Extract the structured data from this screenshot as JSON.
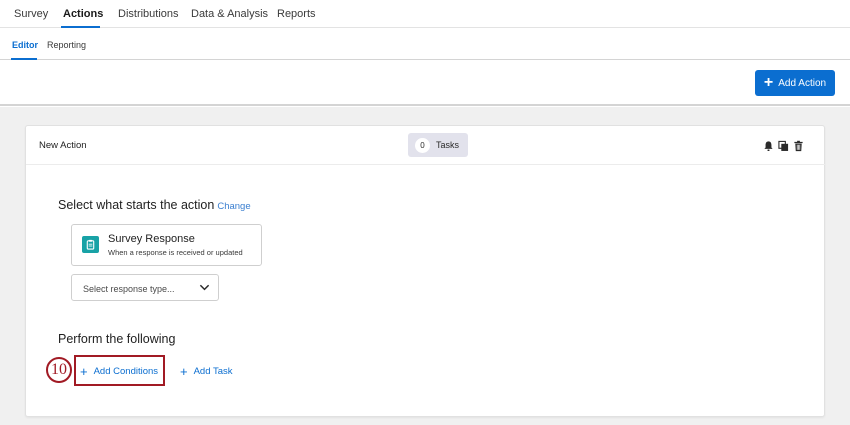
{
  "top_nav": {
    "tabs": [
      "Survey",
      "Actions",
      "Distributions",
      "Data & Analysis",
      "Reports"
    ],
    "active": "Actions"
  },
  "sub_nav": {
    "tabs": [
      "Editor",
      "Reporting"
    ],
    "active": "Editor"
  },
  "toolbar": {
    "add_action_label": "Add Action"
  },
  "action_card": {
    "title": "New Action",
    "tasks_count": "0",
    "tasks_label": "Tasks",
    "header_icons": [
      "bell-icon",
      "copy-icon",
      "trash-icon"
    ]
  },
  "trigger_section": {
    "heading": "Select what starts the action",
    "change_link": "Change",
    "trigger_title": "Survey Response",
    "trigger_subtitle": "When a response is received or updated",
    "trigger_icon": "clipboard-icon",
    "select_placeholder": "Select response type..."
  },
  "perform_section": {
    "heading": "Perform the following",
    "add_conditions_label": "Add Conditions",
    "add_task_label": "Add Task"
  },
  "annotation": {
    "step_number": "10"
  },
  "colors": {
    "accent": "#0b6ed0",
    "highlight": "#a11a24",
    "trigger_icon_bg": "#18a2a6"
  }
}
